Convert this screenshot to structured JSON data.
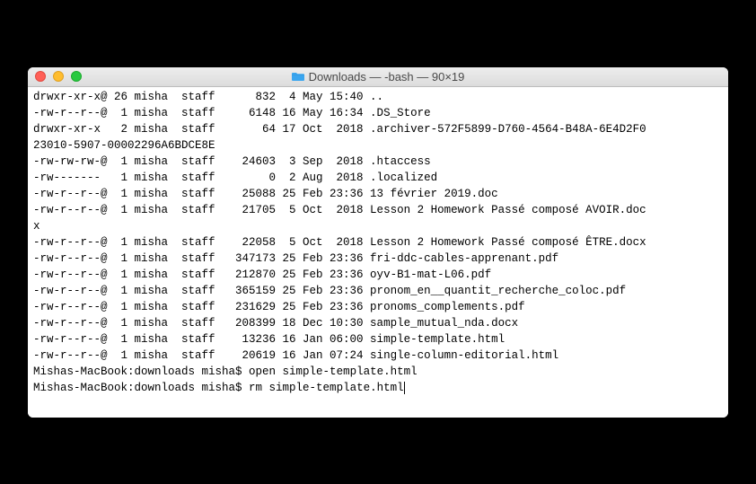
{
  "titlebar": {
    "icon_name": "folder-icon",
    "title": "Downloads — -bash — 90×19"
  },
  "listing": [
    {
      "perm": "drwxr-xr-x@",
      "links": "26",
      "owner": "misha",
      "group": "staff",
      "size": "832",
      "date": " 4 May 15:40",
      "name": ".."
    },
    {
      "perm": "-rw-r--r--@",
      "links": " 1",
      "owner": "misha",
      "group": "staff",
      "size": "6148",
      "date": "16 May 16:34",
      "name": ".DS_Store"
    },
    {
      "perm": "drwxr-xr-x ",
      "links": " 2",
      "owner": "misha",
      "group": "staff",
      "size": "64",
      "date": "17 Oct  2018",
      "name": ".archiver-572F5899-D760-4564-B48A-6E4D2F0",
      "wrap": "23010-5907-00002296A6BDCE8E"
    },
    {
      "perm": "-rw-rw-rw-@",
      "links": " 1",
      "owner": "misha",
      "group": "staff",
      "size": "24603",
      "date": " 3 Sep  2018",
      "name": ".htaccess"
    },
    {
      "perm": "-rw------- ",
      "links": " 1",
      "owner": "misha",
      "group": "staff",
      "size": "0",
      "date": " 2 Aug  2018",
      "name": ".localized"
    },
    {
      "perm": "-rw-r--r--@",
      "links": " 1",
      "owner": "misha",
      "group": "staff",
      "size": "25088",
      "date": "25 Feb 23:36",
      "name": "13 février 2019.doc"
    },
    {
      "perm": "-rw-r--r--@",
      "links": " 1",
      "owner": "misha",
      "group": "staff",
      "size": "21705",
      "date": " 5 Oct  2018",
      "name": "Lesson 2 Homework Passé composé AVOIR.doc",
      "wrap": "x"
    },
    {
      "perm": "-rw-r--r--@",
      "links": " 1",
      "owner": "misha",
      "group": "staff",
      "size": "22058",
      "date": " 5 Oct  2018",
      "name": "Lesson 2 Homework Passé composé ÊTRE.docx"
    },
    {
      "perm": "-rw-r--r--@",
      "links": " 1",
      "owner": "misha",
      "group": "staff",
      "size": "347173",
      "date": "25 Feb 23:36",
      "name": "fri-ddc-cables-apprenant.pdf"
    },
    {
      "perm": "-rw-r--r--@",
      "links": " 1",
      "owner": "misha",
      "group": "staff",
      "size": "212870",
      "date": "25 Feb 23:36",
      "name": "oyv-B1-mat-L06.pdf"
    },
    {
      "perm": "-rw-r--r--@",
      "links": " 1",
      "owner": "misha",
      "group": "staff",
      "size": "365159",
      "date": "25 Feb 23:36",
      "name": "pronom_en__quantit_recherche_coloc.pdf"
    },
    {
      "perm": "-rw-r--r--@",
      "links": " 1",
      "owner": "misha",
      "group": "staff",
      "size": "231629",
      "date": "25 Feb 23:36",
      "name": "pronoms_complements.pdf"
    },
    {
      "perm": "-rw-r--r--@",
      "links": " 1",
      "owner": "misha",
      "group": "staff",
      "size": "208399",
      "date": "18 Dec 10:30",
      "name": "sample_mutual_nda.docx"
    },
    {
      "perm": "-rw-r--r--@",
      "links": " 1",
      "owner": "misha",
      "group": "staff",
      "size": "13236",
      "date": "16 Jan 06:00",
      "name": "simple-template.html"
    },
    {
      "perm": "-rw-r--r--@",
      "links": " 1",
      "owner": "misha",
      "group": "staff",
      "size": "20619",
      "date": "16 Jan 07:24",
      "name": "single-column-editorial.html"
    }
  ],
  "prompt_lines": [
    {
      "prompt": "Mishas-MacBook:downloads misha$ ",
      "cmd": "open simple-template.html",
      "cursor": false
    },
    {
      "prompt": "Mishas-MacBook:downloads misha$ ",
      "cmd": "rm simple-template.html",
      "cursor": true
    }
  ]
}
